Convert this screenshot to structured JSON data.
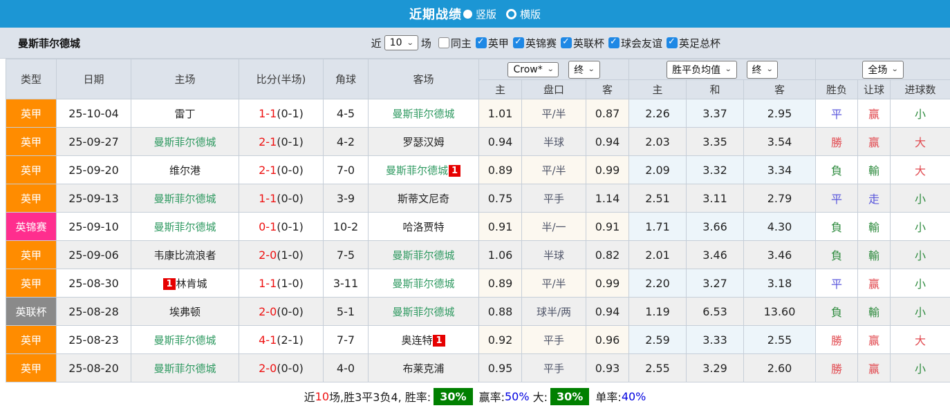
{
  "titlebar": {
    "title": "近期战绩",
    "radio_vertical": "竖版",
    "radio_horizontal": "横版",
    "vertical_selected": true
  },
  "filterbar": {
    "team": "曼斯菲尔德城",
    "recent_label": "近",
    "recent_value": "10",
    "matches_label": "场",
    "same_home_label": "同主",
    "same_home_checked": false,
    "leagues": [
      {
        "label": "英甲",
        "checked": true
      },
      {
        "label": "英锦赛",
        "checked": true
      },
      {
        "label": "英联杯",
        "checked": true
      },
      {
        "label": "球会友谊",
        "checked": true
      },
      {
        "label": "英足总杯",
        "checked": true
      }
    ]
  },
  "table": {
    "header": {
      "type": "类型",
      "date": "日期",
      "home": "主场",
      "score": "比分(半场)",
      "corner": "角球",
      "away": "客场",
      "odds_home": "主",
      "odds_handicap": "盘口",
      "odds_away": "客",
      "avg_home": "主",
      "avg_draw": "和",
      "avg_away": "客",
      "result": "胜负",
      "letball": "让球",
      "goals": "进球数"
    },
    "dropdowns": {
      "bookmaker": "Crow*",
      "bookmaker_time": "终",
      "avg_label": "胜平负均值",
      "avg_time": "终",
      "scope": "全场"
    },
    "rows": [
      {
        "comp": {
          "label": "英甲",
          "color_key": "type_orange"
        },
        "date": "25-10-04",
        "home": {
          "name": "雷丁",
          "green": false
        },
        "score_full": "1-1",
        "score_half": "(0-1)",
        "corner": "4-5",
        "away": {
          "name": "曼斯菲尔德城",
          "green": true
        },
        "odds": [
          "1.01",
          "平/半",
          "0.87"
        ],
        "avg": [
          "2.26",
          "3.37",
          "2.95"
        ],
        "result": {
          "text": "平",
          "color": "blue"
        },
        "letball": {
          "text": "赢",
          "color": "red"
        },
        "goals": {
          "text": "小",
          "color": "green"
        }
      },
      {
        "comp": {
          "label": "英甲",
          "color_key": "type_orange"
        },
        "date": "25-09-27",
        "home": {
          "name": "曼斯菲尔德城",
          "green": true
        },
        "score_full": "2-1",
        "score_half": "(0-1)",
        "corner": "4-2",
        "away": {
          "name": "罗瑟汉姆",
          "green": false
        },
        "odds": [
          "0.94",
          "半球",
          "0.94"
        ],
        "avg": [
          "2.03",
          "3.35",
          "3.54"
        ],
        "result": {
          "text": "勝",
          "color": "red"
        },
        "letball": {
          "text": "赢",
          "color": "red"
        },
        "goals": {
          "text": "大",
          "color": "red"
        }
      },
      {
        "comp": {
          "label": "英甲",
          "color_key": "type_orange"
        },
        "date": "25-09-20",
        "home": {
          "name": "维尔港",
          "green": false
        },
        "score_full": "2-1",
        "score_half": "(0-0)",
        "corner": "7-0",
        "away": {
          "name": "曼斯菲尔德城",
          "green": true,
          "badge": "1",
          "badge_side": "after"
        },
        "odds": [
          "0.89",
          "平/半",
          "0.99"
        ],
        "avg": [
          "2.09",
          "3.32",
          "3.34"
        ],
        "result": {
          "text": "負",
          "color": "green"
        },
        "letball": {
          "text": "輸",
          "color": "green"
        },
        "goals": {
          "text": "大",
          "color": "red"
        }
      },
      {
        "comp": {
          "label": "英甲",
          "color_key": "type_orange"
        },
        "date": "25-09-13",
        "home": {
          "name": "曼斯菲尔德城",
          "green": true
        },
        "score_full": "1-1",
        "score_half": "(0-0)",
        "corner": "3-9",
        "away": {
          "name": "斯蒂文尼奇",
          "green": false
        },
        "odds": [
          "0.75",
          "平手",
          "1.14"
        ],
        "avg": [
          "2.51",
          "3.11",
          "2.79"
        ],
        "result": {
          "text": "平",
          "color": "blue"
        },
        "letball": {
          "text": "走",
          "color": "blue"
        },
        "goals": {
          "text": "小",
          "color": "green"
        }
      },
      {
        "comp": {
          "label": "英锦赛",
          "color_key": "type_pink"
        },
        "date": "25-09-10",
        "home": {
          "name": "曼斯菲尔德城",
          "green": true
        },
        "score_full": "0-1",
        "score_half": "(0-1)",
        "corner": "10-2",
        "away": {
          "name": "哈洛贾特",
          "green": false
        },
        "odds": [
          "0.91",
          "半/一",
          "0.91"
        ],
        "avg": [
          "1.71",
          "3.66",
          "4.30"
        ],
        "result": {
          "text": "負",
          "color": "green"
        },
        "letball": {
          "text": "輸",
          "color": "green"
        },
        "goals": {
          "text": "小",
          "color": "green"
        }
      },
      {
        "comp": {
          "label": "英甲",
          "color_key": "type_orange"
        },
        "date": "25-09-06",
        "home": {
          "name": "韦康比流浪者",
          "green": false
        },
        "score_full": "2-0",
        "score_half": "(1-0)",
        "corner": "7-5",
        "away": {
          "name": "曼斯菲尔德城",
          "green": true
        },
        "odds": [
          "1.06",
          "半球",
          "0.82"
        ],
        "avg": [
          "2.01",
          "3.46",
          "3.46"
        ],
        "result": {
          "text": "負",
          "color": "green"
        },
        "letball": {
          "text": "輸",
          "color": "green"
        },
        "goals": {
          "text": "小",
          "color": "green"
        }
      },
      {
        "comp": {
          "label": "英甲",
          "color_key": "type_orange"
        },
        "date": "25-08-30",
        "home": {
          "name": "林肯城",
          "green": false,
          "badge": "1",
          "badge_side": "before"
        },
        "score_full": "1-1",
        "score_half": "(1-0)",
        "corner": "3-11",
        "away": {
          "name": "曼斯菲尔德城",
          "green": true
        },
        "odds": [
          "0.89",
          "平/半",
          "0.99"
        ],
        "avg": [
          "2.20",
          "3.27",
          "3.18"
        ],
        "result": {
          "text": "平",
          "color": "blue"
        },
        "letball": {
          "text": "赢",
          "color": "red"
        },
        "goals": {
          "text": "小",
          "color": "green"
        }
      },
      {
        "comp": {
          "label": "英联杯",
          "color_key": "type_gray"
        },
        "date": "25-08-28",
        "home": {
          "name": "埃弗顿",
          "green": false
        },
        "score_full": "2-0",
        "score_half": "(0-0)",
        "corner": "5-1",
        "away": {
          "name": "曼斯菲尔德城",
          "green": true
        },
        "odds": [
          "0.88",
          "球半/两",
          "0.94"
        ],
        "avg": [
          "1.19",
          "6.53",
          "13.60"
        ],
        "result": {
          "text": "負",
          "color": "green"
        },
        "letball": {
          "text": "輸",
          "color": "green"
        },
        "goals": {
          "text": "小",
          "color": "green"
        }
      },
      {
        "comp": {
          "label": "英甲",
          "color_key": "type_orange"
        },
        "date": "25-08-23",
        "home": {
          "name": "曼斯菲尔德城",
          "green": true
        },
        "score_full": "4-1",
        "score_half": "(2-1)",
        "corner": "7-7",
        "away": {
          "name": "奥连特",
          "green": false,
          "badge": "1",
          "badge_side": "after"
        },
        "odds": [
          "0.92",
          "平手",
          "0.96"
        ],
        "avg": [
          "2.59",
          "3.33",
          "2.55"
        ],
        "result": {
          "text": "勝",
          "color": "red"
        },
        "letball": {
          "text": "赢",
          "color": "red"
        },
        "goals": {
          "text": "大",
          "color": "red"
        }
      },
      {
        "comp": {
          "label": "英甲",
          "color_key": "type_orange"
        },
        "date": "25-08-20",
        "home": {
          "name": "曼斯菲尔德城",
          "green": true
        },
        "score_full": "2-0",
        "score_half": "(0-0)",
        "corner": "4-0",
        "away": {
          "name": "布莱克浦",
          "green": false
        },
        "odds": [
          "0.95",
          "平手",
          "0.93"
        ],
        "avg": [
          "2.55",
          "3.29",
          "2.60"
        ],
        "result": {
          "text": "勝",
          "color": "red"
        },
        "letball": {
          "text": "赢",
          "color": "red"
        },
        "goals": {
          "text": "小",
          "color": "green"
        }
      }
    ]
  },
  "footer": {
    "segments": [
      {
        "text": "近",
        "style": "plain"
      },
      {
        "text": "10",
        "style": "red"
      },
      {
        "text": "场,胜3平3负4, 胜率:",
        "style": "plain"
      },
      {
        "text": "30%",
        "style": "badge"
      },
      {
        "text": " 赢率:",
        "style": "plain"
      },
      {
        "text": "50%",
        "style": "blue"
      },
      {
        "text": " 大:",
        "style": "plain"
      },
      {
        "text": "30%",
        "style": "badge"
      },
      {
        "text": " 单率:",
        "style": "plain"
      },
      {
        "text": "40%",
        "style": "blue"
      }
    ]
  },
  "colors": {
    "topbar": "#1c96d4",
    "bar_bg": "#dde3eb",
    "row_alt": "#efefef",
    "odds_bg": "#fcf8f0",
    "avg_bg": "#edf5fa",
    "type_orange": "#ff8c00",
    "type_pink": "#ff2e8e",
    "type_gray": "#8a8a8a",
    "team_green": "#2e9960",
    "score_red": "#ee1111",
    "badge_red": "#e60000",
    "result_red": "#e1494f",
    "result_green": "#2e8b3e",
    "result_blue": "#5a57dc",
    "pan_color": "#4e5468",
    "check_blue": "#1e88e5",
    "footer_green": "#008000",
    "footer_blue": "#0000e0",
    "border": "#c6ced8"
  }
}
